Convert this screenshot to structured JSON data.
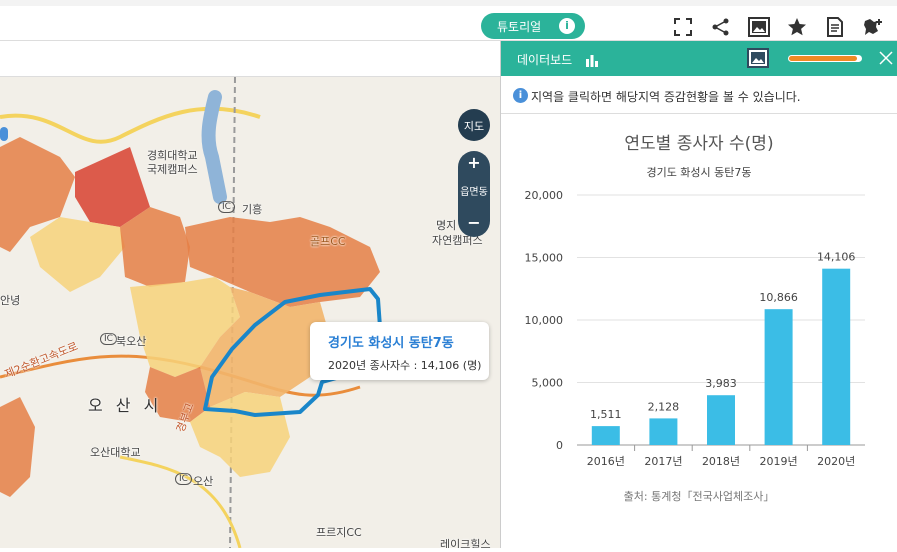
{
  "toolbar": {
    "tutorial_label": "튜토리얼",
    "tutorial_info": "i",
    "icons": [
      "fullscreen-icon",
      "share-icon",
      "image-icon",
      "star-icon",
      "document-icon",
      "add-map-icon"
    ]
  },
  "map": {
    "labels": {
      "univ": "경희대학교",
      "campus": "국제캠퍼스",
      "ic_giheung": "기흥",
      "golf": "골프CC",
      "myongji": "명지",
      "nature": "자연캠퍼스",
      "osan": "오 산 시",
      "osan_univ": "오산대학교",
      "ic_osan": "오산",
      "ic_bukosan": "북오산",
      "ring": "제2순환고속도로",
      "prs": "프르지CC",
      "lake": "레이크힐스",
      "ic": "IC",
      "gyeongbu": "경부고",
      "left_frag": "안녕"
    },
    "control": {
      "map_label": "지도",
      "zoom_in": "+",
      "level": "읍면동",
      "zoom_out": "−"
    },
    "tooltip": {
      "region": "경기도 화성시 동탄7동",
      "detail": "2020년 종사자수 : 14,106 (명)"
    },
    "colors": {
      "dark_red": "#d94a3a",
      "orange": "#e57f45",
      "light_orange": "#f2b56b",
      "yellow": "#f7d27a",
      "highlight_border": "#1a86c9"
    }
  },
  "panel": {
    "title": "데이터보드",
    "progress_value": 0.95,
    "info_icon": "i",
    "info_text": "지역을 클릭하면 해당지역 증감현황을 볼 수 있습니다."
  },
  "chart_data": {
    "type": "bar",
    "title": "연도별 종사자 수(명)",
    "subtitle": "경기도 화성시 동탄7동",
    "categories": [
      "2016년",
      "2017년",
      "2018년",
      "2019년",
      "2020년"
    ],
    "values": [
      1511,
      2128,
      3983,
      10866,
      14106
    ],
    "value_labels": [
      "1,511",
      "2,128",
      "3,983",
      "10,866",
      "14,106"
    ],
    "ylim": [
      0,
      20000
    ],
    "yticks": [
      "0",
      "5,000",
      "10,000",
      "15,000",
      "20,000"
    ],
    "ytick_values": [
      0,
      5000,
      10000,
      15000,
      20000
    ],
    "grid": true,
    "bar_color": "#3bbde6",
    "source": "출처: 통계청「전국사업체조사」"
  }
}
